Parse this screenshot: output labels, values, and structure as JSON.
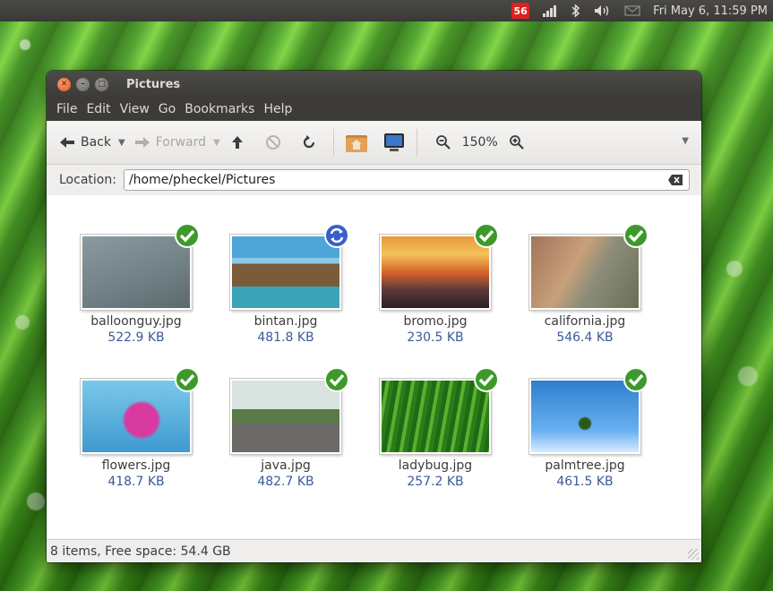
{
  "panel": {
    "notify_badge": "56",
    "clock": "Fri May  6, 11:59 PM"
  },
  "window": {
    "title": "Pictures",
    "menu": [
      "File",
      "Edit",
      "View",
      "Go",
      "Bookmarks",
      "Help"
    ],
    "toolbar": {
      "back_label": "Back",
      "forward_label": "Forward",
      "zoom_level": "150%"
    },
    "location": {
      "label": "Location:",
      "value": "/home/pheckel/Pictures"
    },
    "files": [
      {
        "name": "balloonguy.jpg",
        "size": "522.9 KB",
        "emblem": "check-emblem-icon",
        "thumb": "img-balloon"
      },
      {
        "name": "bintan.jpg",
        "size": "481.8 KB",
        "emblem": "sync-emblem-icon",
        "thumb": "img-bintan"
      },
      {
        "name": "bromo.jpg",
        "size": "230.5 KB",
        "emblem": "check-emblem-icon",
        "thumb": "img-bromo"
      },
      {
        "name": "california.jpg",
        "size": "546.4 KB",
        "emblem": "check-emblem-icon",
        "thumb": "img-california"
      },
      {
        "name": "flowers.jpg",
        "size": "418.7 KB",
        "emblem": "check-emblem-icon",
        "thumb": "img-flowers"
      },
      {
        "name": "java.jpg",
        "size": "482.7 KB",
        "emblem": "check-emblem-icon",
        "thumb": "img-java"
      },
      {
        "name": "ladybug.jpg",
        "size": "257.2 KB",
        "emblem": "check-emblem-icon",
        "thumb": "img-ladybug"
      },
      {
        "name": "palmtree.jpg",
        "size": "461.5 KB",
        "emblem": "check-emblem-icon",
        "thumb": "img-palmtree"
      }
    ],
    "status": "8 items, Free space: 54.4 GB"
  },
  "colors": {
    "panel_bg": "#3c3b37",
    "close_button": "#e9541f",
    "check_emblem": "#3d9a2a",
    "sync_emblem": "#3a5fc8",
    "size_text": "#3a5a9a"
  }
}
